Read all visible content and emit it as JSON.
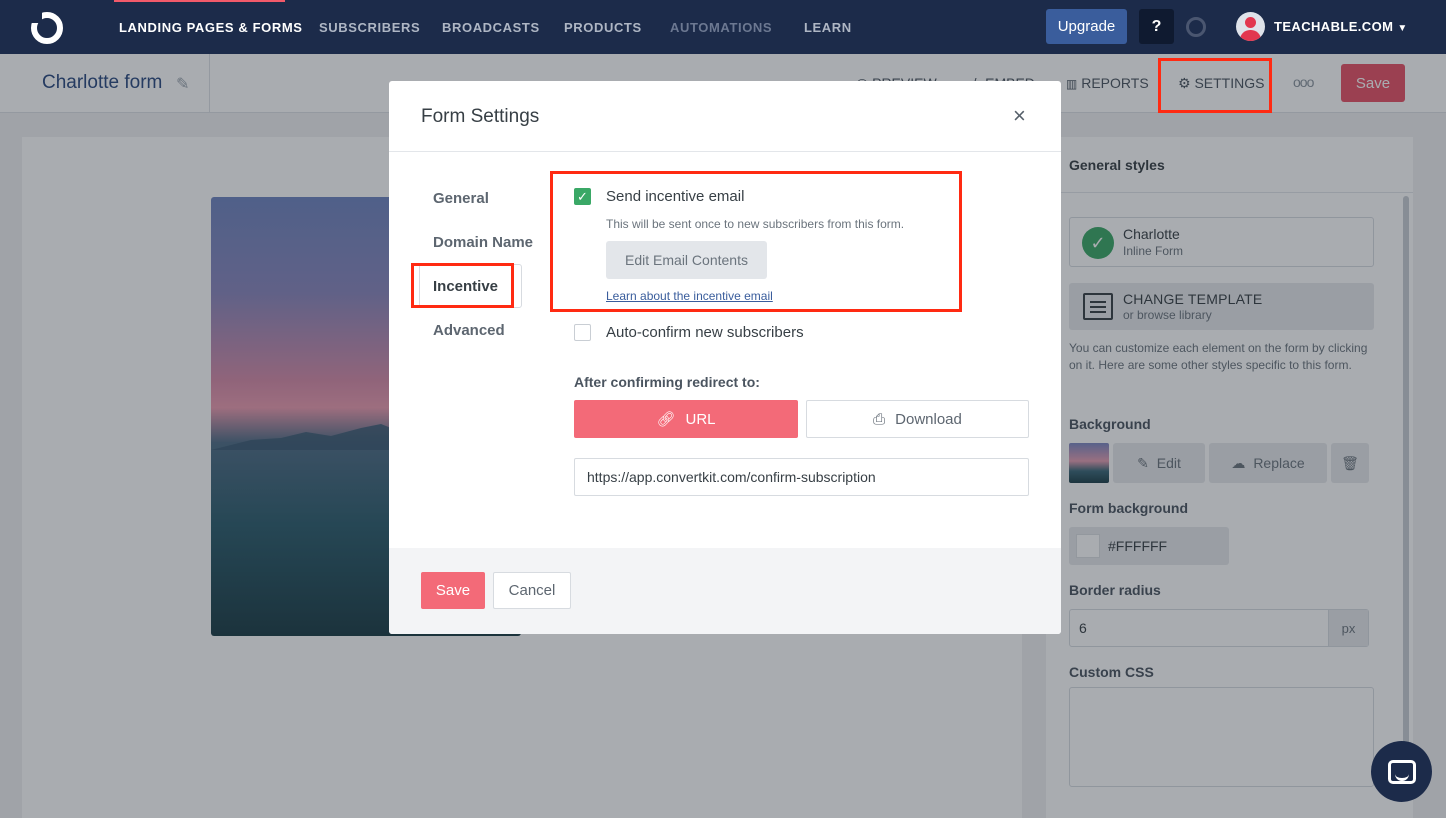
{
  "nav": {
    "items": [
      {
        "label": "LANDING PAGES & FORMS"
      },
      {
        "label": "SUBSCRIBERS"
      },
      {
        "label": "BROADCASTS"
      },
      {
        "label": "PRODUCTS"
      },
      {
        "label": "AUTOMATIONS"
      },
      {
        "label": "LEARN"
      }
    ],
    "upgrade_label": "Upgrade",
    "help_label": "?",
    "account_label": "TEACHABLE.COM"
  },
  "subheader": {
    "form_title": "Charlotte form",
    "preview_label": "PREVIEW",
    "embed_label": "EMBED",
    "reports_label": "REPORTS",
    "settings_label": "SETTINGS",
    "more_label": "ooo",
    "save_label": "Save"
  },
  "right_panel": {
    "header": "General styles",
    "template_card": {
      "title": "Charlotte",
      "subtitle": "Inline Form"
    },
    "change_template": {
      "title": "CHANGE TEMPLATE",
      "subtitle": "or browse library"
    },
    "help_text": "You can customize each element on the form by clicking on it. Here are some other styles specific to this form.",
    "background_label": "Background",
    "edit_label": "Edit",
    "replace_label": "Replace",
    "form_background_label": "Form background",
    "form_background_value": "#FFFFFF",
    "border_radius_label": "Border radius",
    "border_radius_value": "6",
    "border_radius_unit": "px",
    "custom_css_label": "Custom CSS"
  },
  "modal": {
    "title": "Form Settings",
    "close_label": "×",
    "tabs": [
      {
        "label": "General"
      },
      {
        "label": "Domain Name"
      },
      {
        "label": "Incentive"
      },
      {
        "label": "Advanced"
      }
    ],
    "send_incentive": {
      "label": "Send incentive email",
      "checked": true
    },
    "incentive_hint": "This will be sent once to new subscribers from this form.",
    "edit_email_label": "Edit Email Contents",
    "learn_link": "Learn about the incentive email",
    "auto_confirm": {
      "label": "Auto-confirm new subscribers",
      "checked": false
    },
    "redirect_label": "After confirming redirect to:",
    "redirect_options": [
      {
        "label": "URL",
        "selected": true
      },
      {
        "label": "Download",
        "selected": false
      }
    ],
    "redirect_url": "https://app.convertkit.com/confirm-subscription",
    "save_label": "Save",
    "cancel_label": "Cancel"
  },
  "colors": {
    "nav_bg": "#1c2b4a",
    "accent": "#f36a78",
    "success": "#3aa866",
    "highlight": "#ff2a12"
  }
}
